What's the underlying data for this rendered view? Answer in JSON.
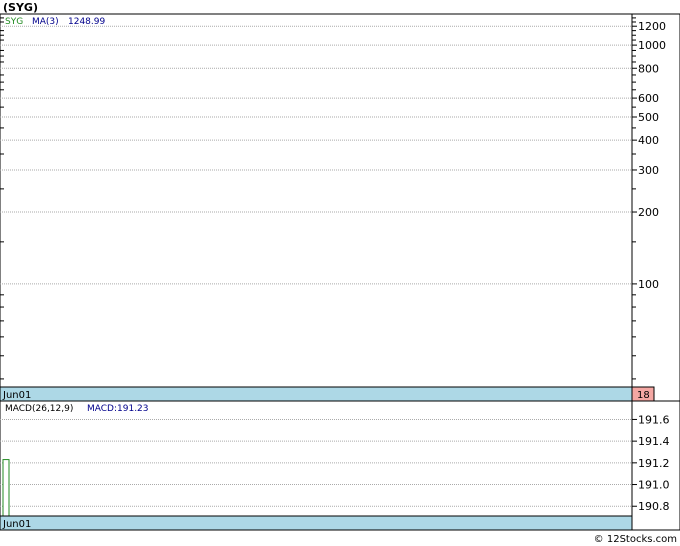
{
  "title": "(SYG)",
  "credit": "© 12Stocks.com",
  "colors": {
    "grid": "#aaaaaa",
    "datebar_bg": "#add8e6",
    "badge_bg": "#f4a7a3",
    "legend_ticker": "#228b22",
    "legend_value": "#00008b",
    "macd_bar": "#228b22"
  },
  "chart_data": [
    {
      "type": "line",
      "scale": "log",
      "legend": {
        "ticker": "SYG",
        "ma_label": "MA(3)",
        "ma_value": "1248.99"
      },
      "y_ticks": [
        1200,
        1000,
        800,
        600,
        500,
        400,
        300,
        200,
        100
      ],
      "y_tick_labels": [
        "1200",
        "1000",
        "800",
        "600",
        "500",
        "400",
        "300",
        "200",
        "100"
      ],
      "ylim": [
        37,
        1350
      ],
      "date_label": "Jun01",
      "badge": "18",
      "series": []
    },
    {
      "type": "bar",
      "legend": {
        "label": "MACD(26,12,9)",
        "value_label": "MACD:191.23"
      },
      "y_ticks": [
        191.6,
        191.4,
        191.2,
        191.0,
        190.8
      ],
      "y_tick_labels": [
        "191.6",
        "191.4",
        "191.2",
        "191.0",
        "190.8"
      ],
      "ylim": [
        190.71,
        191.77
      ],
      "date_label": "Jun01",
      "bars": [
        {
          "x": "Jun01",
          "value": 191.23
        }
      ]
    }
  ]
}
